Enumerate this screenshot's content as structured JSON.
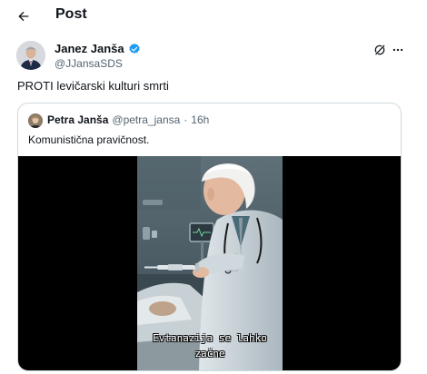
{
  "header": {
    "title": "Post",
    "back_icon": "arrow-left-icon"
  },
  "post": {
    "author_name": "Janez Janša",
    "author_handle": "@JJansaSDS",
    "verified": true,
    "text": "PROTI levičarski kulturi smrti"
  },
  "quote": {
    "author_name": "Petra Janša",
    "author_handle": "@petra_jansa",
    "separator": "·",
    "time": "16h",
    "text": "Komunistična pravičnost.",
    "video_caption_line1": "Evtanazija se lahko",
    "video_caption_line2": "začne"
  },
  "colors": {
    "verified": "#1d9bf0",
    "secondary_text": "#536471",
    "border": "#cfd9de"
  }
}
